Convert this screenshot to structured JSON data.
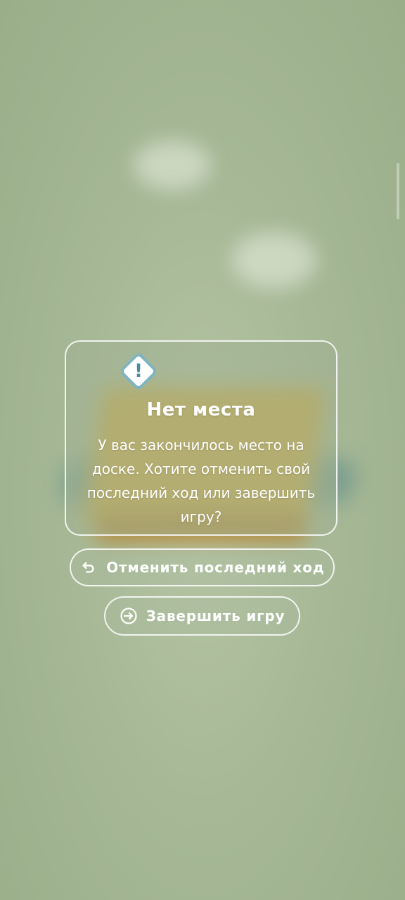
{
  "dialog": {
    "icon": "warning-icon",
    "title": "Нет места",
    "message": "У вас закончилось место на доске. Хотите отменить свой последний ход или завершить игру?"
  },
  "actions": {
    "undo_label": "Отменить последний ход",
    "undo_icon": "undo-arrow-icon",
    "finish_label": "Завершить игру",
    "finish_icon": "exit-arrow-icon"
  },
  "colors": {
    "background": "#a6b896",
    "accent_icon": "#7fb4c2",
    "text": "#ffffff"
  }
}
